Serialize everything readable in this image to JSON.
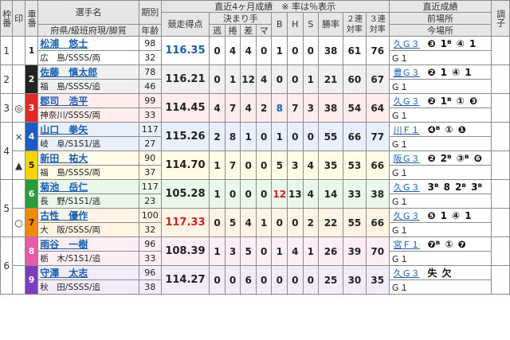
{
  "header": {
    "waku": "枠番",
    "shirushi": "印",
    "sha": "車番",
    "senshu": "選手名",
    "senshu_sub": "府県/級班府現/脚質",
    "kibetsu": "期別",
    "nenrei": "年齢",
    "recent4": "直近4ヶ月成績　※ 率は％表示",
    "kyosou": "競走得点",
    "kimarite": "決まり手",
    "nige": "逃",
    "makuri": "捲",
    "sashi": "差",
    "ma": "マ",
    "b": "B",
    "h": "H",
    "s": "S",
    "shoritsu": "勝率",
    "nirentai": "２連対率",
    "sanrentai": "３連対率",
    "recent": "直近成績",
    "zenba": "前場所",
    "konba": "今場所",
    "chosei": "調子"
  },
  "racers": [
    {
      "waku": "1",
      "shirushi": "",
      "ban": "1",
      "name": "松浦　悠士",
      "area": "広　島/SSSS/両",
      "ki": "98",
      "age": "32",
      "points": "116.35",
      "pts_color": "blue",
      "nige": "0",
      "makuri": "4",
      "sashi": "4",
      "ma": "0",
      "b": "1",
      "h": "0",
      "s": "0",
      "win": "38",
      "r2": "61",
      "r3": "76",
      "zen_venue": "久Ｇ３",
      "zen_results": [
        "❸",
        "1ᴮ",
        "④",
        "1"
      ],
      "kon_venue": "Ｇ１"
    },
    {
      "waku": "2",
      "shirushi": "",
      "ban": "2",
      "name": "佐藤　慎太郎",
      "area": "福　島/SSSS/追",
      "ki": "78",
      "age": "46",
      "points": "116.21",
      "pts_color": "",
      "nige": "0",
      "makuri": "1",
      "sashi": "12",
      "ma": "4",
      "b": "0",
      "h": "0",
      "s": "1",
      "win": "21",
      "r2": "60",
      "r3": "67",
      "zen_venue": "豊Ｇ３",
      "zen_results": [
        "❷",
        "1",
        "④",
        "1"
      ],
      "kon_venue": "Ｇ１"
    },
    {
      "waku": "3",
      "shirushi": "◎",
      "ban": "3",
      "name": "郡司　浩平",
      "area": "神奈川/SSSS/両",
      "ki": "99",
      "age": "33",
      "points": "114.45",
      "pts_color": "",
      "nige": "4",
      "makuri": "7",
      "sashi": "4",
      "ma": "2",
      "b": "8",
      "h": "7",
      "s": "3",
      "win": "38",
      "r2": "54",
      "r3": "64",
      "zen_venue": "久Ｇ３",
      "zen_results": [
        "❷",
        "1ᴮ",
        "①",
        "❸"
      ],
      "kon_venue": "Ｇ１"
    },
    {
      "waku": "4",
      "shirushi": "×",
      "ban": "4",
      "name": "山口　拳矢",
      "area": "岐　阜/S1S1/逃",
      "ki": "117",
      "age": "27",
      "points": "115.26",
      "pts_color": "",
      "nige": "2",
      "makuri": "8",
      "sashi": "1",
      "ma": "0",
      "b": "1",
      "h": "0",
      "s": "0",
      "win": "55",
      "r2": "66",
      "r3": "77",
      "zen_venue": "川Ｆ１",
      "zen_results": [
        "❹ᴮ",
        "①",
        "❶"
      ],
      "kon_venue": "Ｇ１"
    },
    {
      "waku": "4",
      "shirushi": "▲",
      "ban": "5",
      "name": "新田　祐大",
      "area": "福　島/SSSS/両",
      "ki": "90",
      "age": "37",
      "points": "114.70",
      "pts_color": "",
      "nige": "1",
      "makuri": "7",
      "sashi": "0",
      "ma": "0",
      "b": "5",
      "h": "3",
      "s": "4",
      "win": "35",
      "r2": "53",
      "r3": "66",
      "zen_venue": "阪Ｇ３",
      "zen_results": [
        "❷",
        "2ᴮ",
        "③ᴮ",
        "❻"
      ],
      "kon_venue": "Ｇ１"
    },
    {
      "waku": "5",
      "shirushi": "",
      "ban": "6",
      "name": "菊池　岳仁",
      "area": "長　野/S1S1/逃",
      "ki": "117",
      "age": "23",
      "points": "105.28",
      "pts_color": "",
      "nige": "1",
      "makuri": "0",
      "sashi": "0",
      "ma": "0",
      "b": "12",
      "h": "13",
      "s": "4",
      "win": "14",
      "r2": "33",
      "r3": "38",
      "zen_venue": "久Ｇ３",
      "zen_results": [
        "3ᴮ",
        "8",
        "2ᴮ",
        "3ᴮ"
      ],
      "kon_venue": "Ｇ１"
    },
    {
      "waku": "5",
      "shirushi": "○",
      "ban": "7",
      "name": "古性　優作",
      "area": "大　阪/SSSS/両",
      "ki": "100",
      "age": "32",
      "points": "117.33",
      "pts_color": "red",
      "nige": "0",
      "makuri": "5",
      "sashi": "4",
      "ma": "1",
      "b": "0",
      "h": "0",
      "s": "2",
      "win": "22",
      "r2": "55",
      "r3": "66",
      "zen_venue": "久Ｇ３",
      "zen_results": [
        "❺",
        "1",
        "④",
        "1"
      ],
      "kon_venue": "Ｇ１"
    },
    {
      "waku": "6",
      "shirushi": "",
      "ban": "8",
      "name": "雨谷　一樹",
      "area": "栃　木/S1S1/追",
      "ki": "96",
      "age": "33",
      "points": "108.39",
      "pts_color": "",
      "nige": "1",
      "makuri": "3",
      "sashi": "5",
      "ma": "0",
      "b": "1",
      "h": "4",
      "s": "1",
      "win": "26",
      "r2": "39",
      "r3": "70",
      "zen_venue": "宮Ｆ１",
      "zen_results": [
        "❼ᴮ",
        "①",
        "❼"
      ],
      "kon_venue": "Ｇ１"
    },
    {
      "waku": "6",
      "shirushi": "",
      "ban": "9",
      "name": "守澤　太志",
      "area": "秋　田/SSSS/追",
      "ki": "96",
      "age": "38",
      "points": "114.27",
      "pts_color": "",
      "nige": "0",
      "makuri": "0",
      "sashi": "6",
      "ma": "0",
      "b": "0",
      "h": "0",
      "s": "0",
      "win": "25",
      "r2": "30",
      "r3": "35",
      "zen_venue": "久Ｇ３",
      "zen_results": [
        "失",
        "欠"
      ],
      "kon_venue": "Ｇ１"
    }
  ]
}
